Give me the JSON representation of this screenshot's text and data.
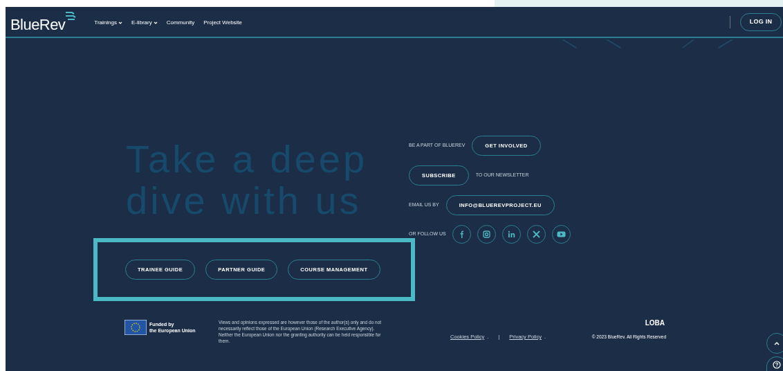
{
  "header": {
    "logo": "BlueRev",
    "nav": [
      {
        "label": "Trainings",
        "dropdown": true
      },
      {
        "label": "E-library",
        "dropdown": true
      },
      {
        "label": "Community",
        "dropdown": false
      },
      {
        "label": "Project Website",
        "dropdown": false
      }
    ],
    "login": "LOG IN"
  },
  "hero": {
    "heading_lines": [
      "Take a deep",
      "dive with us"
    ],
    "guides": [
      "TRAINEE GUIDE",
      "PARTNER GUIDE",
      "COURSE MANAGEMENT"
    ]
  },
  "contact": [
    {
      "kind": "label-first",
      "label": "BE A PART OF BLUEREV",
      "button": "GET INVOLVED"
    },
    {
      "kind": "button-first",
      "button": "SUBSCRIBE",
      "label": "TO OUR NEWSLETTER"
    },
    {
      "kind": "label-first",
      "label": "EMAIL US BY",
      "button": "INFO@BLUEREVPROJECT.EU"
    }
  ],
  "follow": {
    "label": "OR FOLLOW US",
    "networks": [
      {
        "kind": "facebook"
      },
      {
        "kind": "instagram"
      },
      {
        "kind": "linkedin"
      },
      {
        "kind": "x"
      },
      {
        "kind": "youtube"
      }
    ]
  },
  "footer": {
    "eu_lines": [
      "Funded by",
      "the European Union"
    ],
    "disclaimer": "Views and opinions expressed are however those of the author(s) only and do not necessarily reflect those of the European Union (Research Executive Agency). Neither the European Union nor the granting authority can be held responsible for them.",
    "links": [
      {
        "label": "Cookies Policy",
        "suffix": "."
      },
      {
        "label": "Privacy Policy",
        "suffix": "."
      }
    ],
    "separator": "|",
    "agency_logo": "LOBA",
    "copyright": "© 2023 BlueRev. All Rights Reserved"
  }
}
